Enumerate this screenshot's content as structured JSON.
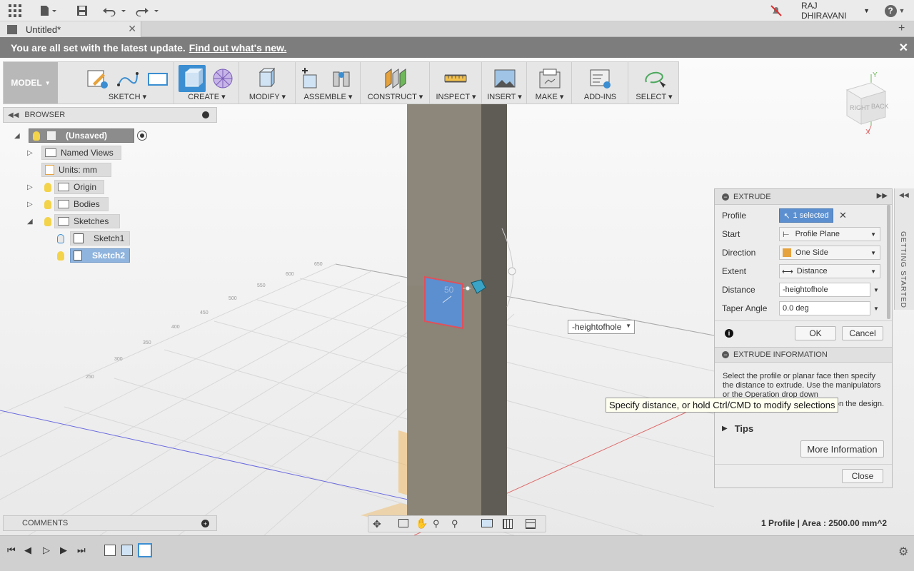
{
  "app": {
    "user_name": "RAJ DHIRAVANI",
    "help_label": "?",
    "doc_tab_title": "Untitled*"
  },
  "notification": {
    "message": "You are all set with the latest update.",
    "link": "Find out what's new."
  },
  "ribbon": {
    "workspace": "MODEL",
    "groups": [
      "SKETCH",
      "CREATE",
      "MODIFY",
      "ASSEMBLE",
      "CONSTRUCT",
      "INSPECT",
      "INSERT",
      "MAKE",
      "ADD-INS",
      "SELECT"
    ]
  },
  "browser": {
    "title": "BROWSER",
    "root": "(Unsaved)",
    "named_views": "Named Views",
    "units": "Units: mm",
    "origin": "Origin",
    "bodies": "Bodies",
    "sketches": "Sketches",
    "sketch1": "Sketch1",
    "sketch2": "Sketch2"
  },
  "comments": {
    "title": "COMMENTS"
  },
  "viewcube": {
    "right": "RIGHT",
    "back": "BACK",
    "y_axis": "Y",
    "x_axis": "X"
  },
  "viewport": {
    "sketch_dim": "50",
    "distance_input": "-heightofhole",
    "tooltip": "Specify distance, or hold Ctrl/CMD to modify selections"
  },
  "extrude": {
    "title": "EXTRUDE",
    "profile_label": "Profile",
    "profile_value": "1 selected",
    "start_label": "Start",
    "start_value": "Profile Plane",
    "direction_label": "Direction",
    "direction_value": "One Side",
    "extent_label": "Extent",
    "extent_value": "Distance",
    "distance_label": "Distance",
    "distance_value": "-heightofhole",
    "taper_label": "Taper Angle",
    "taper_value": "0.0 deg",
    "ok": "OK",
    "cancel": "Cancel",
    "info_title": "EXTRUDE INFORMATION",
    "info_text": "Select the profile or planar face then specify the distance to extrude. Use the manipulators or the Operation drop down",
    "info_text_tail": "s on the design.",
    "tips": "Tips",
    "more_info": "More Information",
    "close": "Close"
  },
  "getting_started": "GETTING STARTED",
  "status": "1 Profile | Area : 2500.00 mm^2",
  "colors": {
    "accent_blue": "#3b8ed1",
    "selection_blue": "#5b8fcf",
    "body_gray": "#8a8577",
    "profile_red": "#e0505a"
  }
}
